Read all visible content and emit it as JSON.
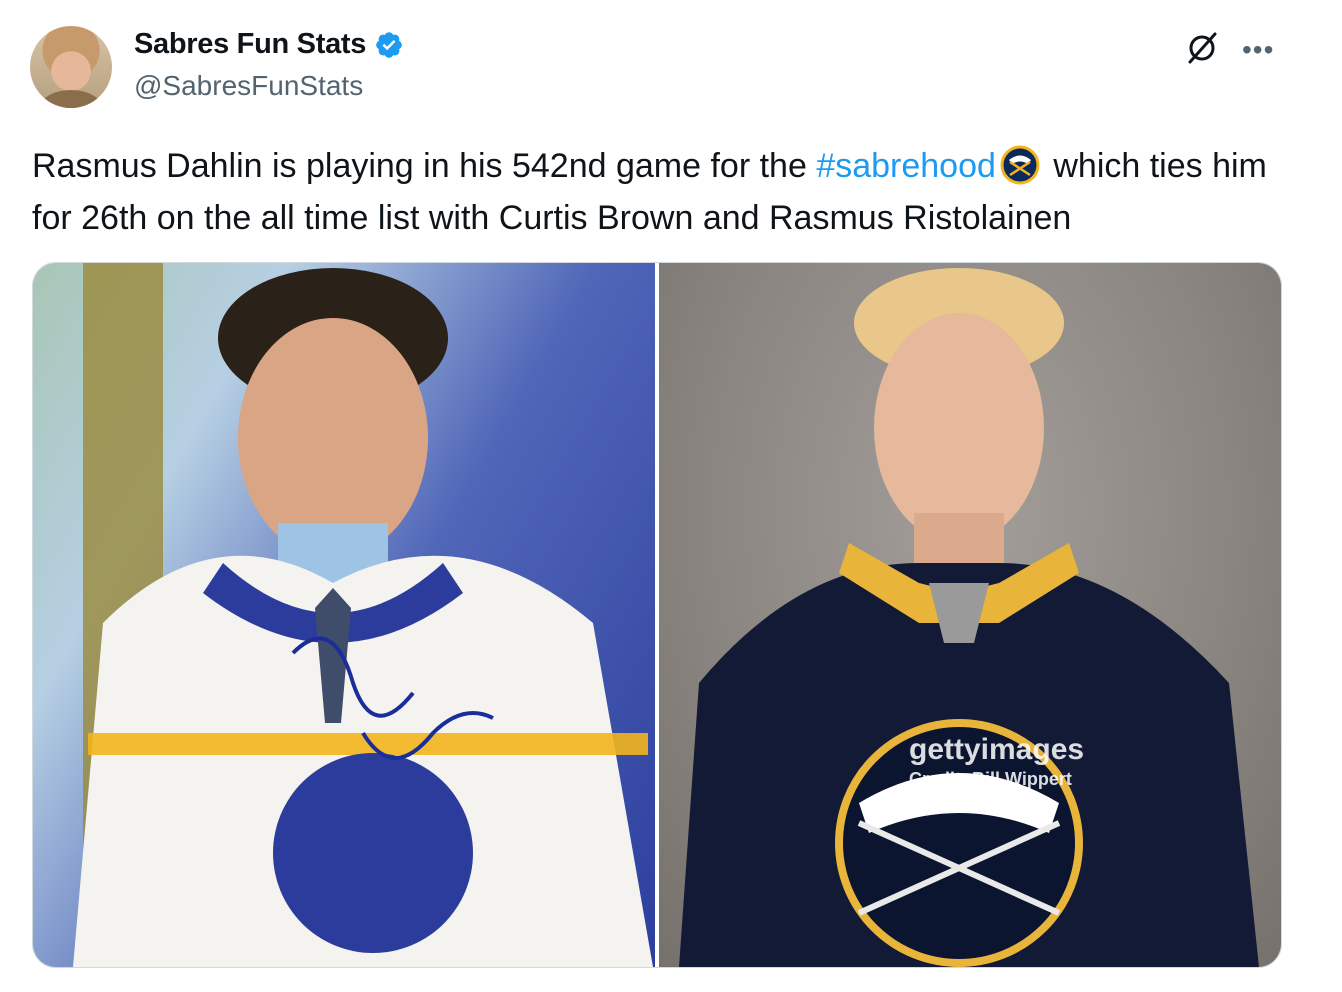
{
  "author": {
    "display_name": "Sabres Fun Stats",
    "handle": "@SabresFunStats"
  },
  "icons": {
    "verified": "verified-badge-icon",
    "grok": "grok-icon",
    "more": "more-options-icon",
    "emoji": "sabres-logo-emoji"
  },
  "tweet": {
    "text_before": "Rasmus Dahlin is playing in his 542nd game for the ",
    "hashtag": "#sabrehood",
    "text_after": " which ties him for 26th on the all time list with Curtis Brown and Rasmus Ristolainen"
  },
  "media": {
    "right_image": {
      "watermark_logo": "gettyimages",
      "watermark_credit": "Credit: Bill Wippert"
    }
  },
  "colors": {
    "hashtag": "#1d9bf0",
    "verified": "#1d9bf0",
    "secondary_text": "#536471"
  }
}
